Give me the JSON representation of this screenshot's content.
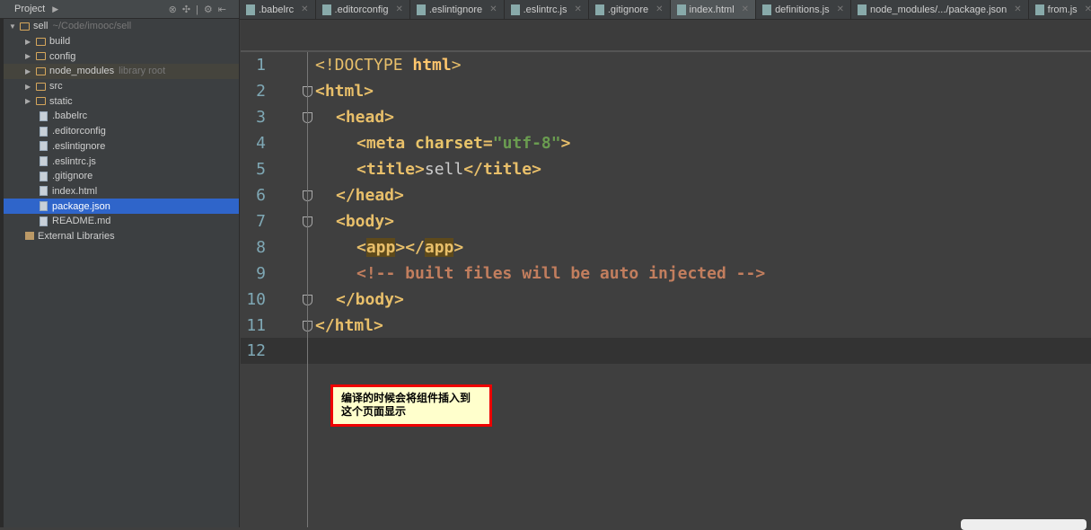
{
  "sidebar": {
    "title": "Project",
    "root": {
      "name": "sell",
      "path": "~/Code/imooc/sell"
    },
    "items": [
      {
        "label": "build",
        "type": "folder"
      },
      {
        "label": "config",
        "type": "folder"
      },
      {
        "label": "node_modules",
        "type": "folder",
        "note": "library root"
      },
      {
        "label": "src",
        "type": "folder"
      },
      {
        "label": "static",
        "type": "folder"
      },
      {
        "label": ".babelrc",
        "type": "file"
      },
      {
        "label": ".editorconfig",
        "type": "file"
      },
      {
        "label": ".eslintignore",
        "type": "file"
      },
      {
        "label": ".eslintrc.js",
        "type": "file"
      },
      {
        "label": ".gitignore",
        "type": "file"
      },
      {
        "label": "index.html",
        "type": "file"
      },
      {
        "label": "package.json",
        "type": "file",
        "selected": true
      },
      {
        "label": "README.md",
        "type": "file"
      }
    ],
    "external": "External Libraries"
  },
  "tabs": [
    {
      "label": ".babelrc"
    },
    {
      "label": ".editorconfig"
    },
    {
      "label": ".eslintignore"
    },
    {
      "label": ".eslintrc.js"
    },
    {
      "label": ".gitignore"
    },
    {
      "label": "index.html",
      "active": true
    },
    {
      "label": "definitions.js"
    },
    {
      "label": "node_modules/.../package.json"
    },
    {
      "label": "from.js"
    }
  ],
  "editor": {
    "lines": [
      "1",
      "2",
      "3",
      "4",
      "5",
      "6",
      "7",
      "8",
      "9",
      "10",
      "11",
      "12"
    ],
    "code": {
      "l1a": "<!DOCTYPE ",
      "l1b": "html",
      ">": ">",
      "l2": "<html>",
      "l3": "<head>",
      "l4a": "<meta ",
      "l4b": "charset",
      "l4c": "=",
      "l4d": "\"utf-8\"",
      "l5a": "<title>",
      "l5b": "sell",
      "l5c": "</title>",
      "l6": "</head>",
      "l7": "<body>",
      "l8a": "<",
      "l8b": "app",
      "l8c": "></",
      "l8d": "app",
      "l9": "<!-- built files will be auto injected -->",
      "l10": "</body>",
      "l11": "</html>"
    }
  },
  "note": {
    "line1": "编译的时候会将组件插入到",
    "line2": "这个页面显示"
  }
}
